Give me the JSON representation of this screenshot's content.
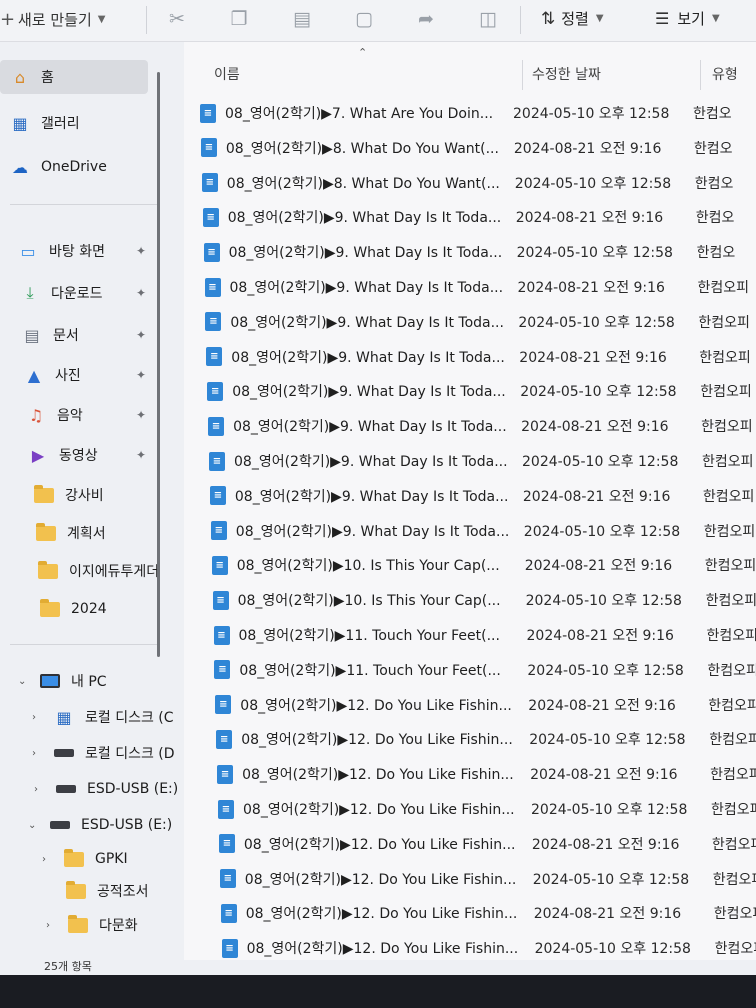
{
  "toolbar": {
    "new_label": "새로 만들기",
    "sort_label": "정렬",
    "view_label": "보기"
  },
  "sidebar": {
    "quick": [
      {
        "label": "홈",
        "icon": "home-icon"
      },
      {
        "label": "갤러리",
        "icon": "gallery-icon"
      },
      {
        "label": "OneDrive",
        "icon": "cloud-icon"
      }
    ],
    "pinned": [
      {
        "label": "바탕 화면",
        "icon": "desktop-icon"
      },
      {
        "label": "다운로드",
        "icon": "download-icon"
      },
      {
        "label": "문서",
        "icon": "document-icon"
      },
      {
        "label": "사진",
        "icon": "pictures-icon"
      },
      {
        "label": "음악",
        "icon": "music-icon"
      },
      {
        "label": "동영상",
        "icon": "video-icon"
      }
    ],
    "folders": [
      "강사비",
      "계획서",
      "이지에듀투게더",
      "2024"
    ],
    "pc_label": "내 PC",
    "drives": [
      {
        "label": "로컬 디스크 (C"
      },
      {
        "label": "로컬 디스크 (D"
      },
      {
        "label": "ESD-USB (E:)"
      }
    ],
    "usb_label": "ESD-USB (E:)",
    "usb_children": [
      "GPKI",
      "공적조서",
      "다문화"
    ],
    "status": "25개 항목"
  },
  "columns": {
    "name": "이름",
    "modified": "수정한 날짜",
    "type": "유형"
  },
  "files": [
    {
      "name": "08_영어(2학기)▶7. What Are You Doin...",
      "date": "2024-05-10 오후 12:58",
      "type": "한컴오"
    },
    {
      "name": "08_영어(2학기)▶8. What Do You Want(...",
      "date": "2024-08-21 오전 9:16",
      "type": "한컴오"
    },
    {
      "name": "08_영어(2학기)▶8. What Do You Want(...",
      "date": "2024-05-10 오후 12:58",
      "type": "한컴오"
    },
    {
      "name": "08_영어(2학기)▶9. What Day Is It Toda...",
      "date": "2024-08-21 오전 9:16",
      "type": "한컴오"
    },
    {
      "name": "08_영어(2학기)▶9. What Day Is It Toda...",
      "date": "2024-05-10 오후 12:58",
      "type": "한컴오"
    },
    {
      "name": "08_영어(2학기)▶9. What Day Is It Toda...",
      "date": "2024-08-21 오전 9:16",
      "type": "한컴오피"
    },
    {
      "name": "08_영어(2학기)▶9. What Day Is It Toda...",
      "date": "2024-05-10 오후 12:58",
      "type": "한컴오피"
    },
    {
      "name": "08_영어(2학기)▶9. What Day Is It Toda...",
      "date": "2024-08-21 오전 9:16",
      "type": "한컴오피"
    },
    {
      "name": "08_영어(2학기)▶9. What Day Is It Toda...",
      "date": "2024-05-10 오후 12:58",
      "type": "한컴오피"
    },
    {
      "name": "08_영어(2학기)▶9. What Day Is It Toda...",
      "date": "2024-08-21 오전 9:16",
      "type": "한컴오피"
    },
    {
      "name": "08_영어(2학기)▶9. What Day Is It Toda...",
      "date": "2024-05-10 오후 12:58",
      "type": "한컴오피"
    },
    {
      "name": "08_영어(2학기)▶9. What Day Is It Toda...",
      "date": "2024-08-21 오전 9:16",
      "type": "한컴오피"
    },
    {
      "name": "08_영어(2학기)▶9. What Day Is It Toda...",
      "date": "2024-05-10 오후 12:58",
      "type": "한컴오피스"
    },
    {
      "name": "08_영어(2학기)▶10. Is This Your Cap(...",
      "date": "2024-08-21 오전 9:16",
      "type": "한컴오피스"
    },
    {
      "name": "08_영어(2학기)▶10. Is This Your Cap(...",
      "date": "2024-05-10 오후 12:58",
      "type": "한컴오피스"
    },
    {
      "name": "08_영어(2학기)▶11. Touch Your Feet(...",
      "date": "2024-08-21 오전 9:16",
      "type": "한컴오피스"
    },
    {
      "name": "08_영어(2학기)▶11. Touch Your Feet(...",
      "date": "2024-05-10 오후 12:58",
      "type": "한컴오피스"
    },
    {
      "name": "08_영어(2학기)▶12. Do You Like Fishin...",
      "date": "2024-08-21 오전 9:16",
      "type": "한컴오피스"
    },
    {
      "name": "08_영어(2학기)▶12. Do You Like Fishin...",
      "date": "2024-05-10 오후 12:58",
      "type": "한컴오피스"
    },
    {
      "name": "08_영어(2학기)▶12. Do You Like Fishin...",
      "date": "2024-08-21 오전 9:16",
      "type": "한컴오피스"
    },
    {
      "name": "08_영어(2학기)▶12. Do You Like Fishin...",
      "date": "2024-05-10 오후 12:58",
      "type": "한컴오피스"
    },
    {
      "name": "08_영어(2학기)▶12. Do You Like Fishin...",
      "date": "2024-08-21 오전 9:16",
      "type": "한컴오피스"
    },
    {
      "name": "08_영어(2학기)▶12. Do You Like Fishin...",
      "date": "2024-05-10 오후 12:58",
      "type": "한컴오피스"
    },
    {
      "name": "08_영어(2학기)▶12. Do You Like Fishin...",
      "date": "2024-08-21 오전 9:16",
      "type": "한컴오피스"
    },
    {
      "name": "08_영어(2학기)▶12. Do You Like Fishin...",
      "date": "2024-05-10 오후 12:58",
      "type": "한컴오피스"
    }
  ]
}
